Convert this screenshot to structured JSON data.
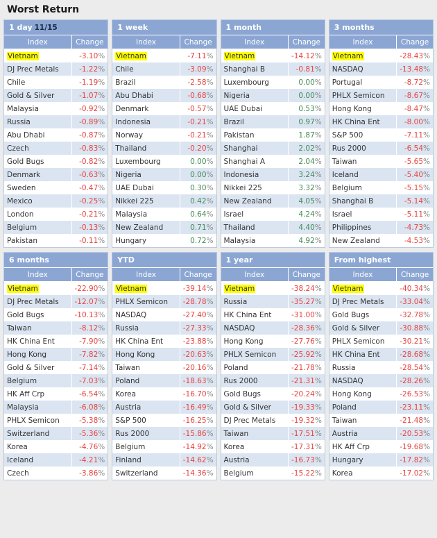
{
  "page": {
    "title": "Worst Return"
  },
  "columns": {
    "index": "Index",
    "change": "Change"
  },
  "panels": [
    {
      "id": "1-day",
      "title": "1 day",
      "date": "11/15",
      "rows": [
        {
          "index": "Vietnam",
          "highlight": true,
          "value": "-3.10",
          "pct": "%",
          "sign": "neg"
        },
        {
          "index": "DJ Prec Metals",
          "highlight": false,
          "value": "-1.22",
          "pct": "%",
          "sign": "neg"
        },
        {
          "index": "Chile",
          "highlight": false,
          "value": "-1.19",
          "pct": "%",
          "sign": "neg"
        },
        {
          "index": "Gold & Silver",
          "highlight": false,
          "value": "-1.07",
          "pct": "%",
          "sign": "neg"
        },
        {
          "index": "Malaysia",
          "highlight": false,
          "value": "-0.92",
          "pct": "%",
          "sign": "neg"
        },
        {
          "index": "Russia",
          "highlight": false,
          "value": "-0.89",
          "pct": "%",
          "sign": "neg"
        },
        {
          "index": "Abu Dhabi",
          "highlight": false,
          "value": "-0.87",
          "pct": "%",
          "sign": "neg"
        },
        {
          "index": "Czech",
          "highlight": false,
          "value": "-0.83",
          "pct": "%",
          "sign": "neg"
        },
        {
          "index": "Gold Bugs",
          "highlight": false,
          "value": "-0.82",
          "pct": "%",
          "sign": "neg"
        },
        {
          "index": "Denmark",
          "highlight": false,
          "value": "-0.63",
          "pct": "%",
          "sign": "neg"
        },
        {
          "index": "Sweden",
          "highlight": false,
          "value": "-0.47",
          "pct": "%",
          "sign": "neg"
        },
        {
          "index": "Mexico",
          "highlight": false,
          "value": "-0.25",
          "pct": "%",
          "sign": "neg"
        },
        {
          "index": "London",
          "highlight": false,
          "value": "-0.21",
          "pct": "%",
          "sign": "neg"
        },
        {
          "index": "Belgium",
          "highlight": false,
          "value": "-0.13",
          "pct": "%",
          "sign": "neg"
        },
        {
          "index": "Pakistan",
          "highlight": false,
          "value": "-0.11",
          "pct": "%",
          "sign": "neg"
        }
      ]
    },
    {
      "id": "1-week",
      "title": "1 week",
      "date": "",
      "rows": [
        {
          "index": "Vietnam",
          "highlight": true,
          "value": "-7.11",
          "pct": "%",
          "sign": "neg"
        },
        {
          "index": "Chile",
          "highlight": false,
          "value": "-3.09",
          "pct": "%",
          "sign": "neg"
        },
        {
          "index": "Brazil",
          "highlight": false,
          "value": "-2.58",
          "pct": "%",
          "sign": "neg"
        },
        {
          "index": "Abu Dhabi",
          "highlight": false,
          "value": "-0.68",
          "pct": "%",
          "sign": "neg"
        },
        {
          "index": "Denmark",
          "highlight": false,
          "value": "-0.57",
          "pct": "%",
          "sign": "neg"
        },
        {
          "index": "Indonesia",
          "highlight": false,
          "value": "-0.21",
          "pct": "%",
          "sign": "neg"
        },
        {
          "index": "Norway",
          "highlight": false,
          "value": "-0.21",
          "pct": "%",
          "sign": "neg"
        },
        {
          "index": "Thailand",
          "highlight": false,
          "value": "-0.20",
          "pct": "%",
          "sign": "neg"
        },
        {
          "index": "Luxembourg",
          "highlight": false,
          "value": "0.00",
          "pct": "%",
          "sign": "pos"
        },
        {
          "index": "Nigeria",
          "highlight": false,
          "value": "0.00",
          "pct": "%",
          "sign": "pos"
        },
        {
          "index": "UAE Dubai",
          "highlight": false,
          "value": "0.30",
          "pct": "%",
          "sign": "pos"
        },
        {
          "index": "Nikkei 225",
          "highlight": false,
          "value": "0.42",
          "pct": "%",
          "sign": "pos"
        },
        {
          "index": "Malaysia",
          "highlight": false,
          "value": "0.64",
          "pct": "%",
          "sign": "pos"
        },
        {
          "index": "New Zealand",
          "highlight": false,
          "value": "0.71",
          "pct": "%",
          "sign": "pos"
        },
        {
          "index": "Hungary",
          "highlight": false,
          "value": "0.72",
          "pct": "%",
          "sign": "pos"
        }
      ]
    },
    {
      "id": "1-month",
      "title": "1 month",
      "date": "",
      "rows": [
        {
          "index": "Vietnam",
          "highlight": true,
          "value": "-14.12",
          "pct": "%",
          "sign": "neg"
        },
        {
          "index": "Shanghai B",
          "highlight": false,
          "value": "-0.81",
          "pct": "%",
          "sign": "neg"
        },
        {
          "index": "Luxembourg",
          "highlight": false,
          "value": "0.00",
          "pct": "%",
          "sign": "pos"
        },
        {
          "index": "Nigeria",
          "highlight": false,
          "value": "0.00",
          "pct": "%",
          "sign": "pos"
        },
        {
          "index": "UAE Dubai",
          "highlight": false,
          "value": "0.53",
          "pct": "%",
          "sign": "pos"
        },
        {
          "index": "Brazil",
          "highlight": false,
          "value": "0.97",
          "pct": "%",
          "sign": "pos"
        },
        {
          "index": "Pakistan",
          "highlight": false,
          "value": "1.87",
          "pct": "%",
          "sign": "pos"
        },
        {
          "index": "Shanghai",
          "highlight": false,
          "value": "2.02",
          "pct": "%",
          "sign": "pos"
        },
        {
          "index": "Shanghai A",
          "highlight": false,
          "value": "2.04",
          "pct": "%",
          "sign": "pos"
        },
        {
          "index": "Indonesia",
          "highlight": false,
          "value": "3.24",
          "pct": "%",
          "sign": "pos"
        },
        {
          "index": "Nikkei 225",
          "highlight": false,
          "value": "3.32",
          "pct": "%",
          "sign": "pos"
        },
        {
          "index": "New Zealand",
          "highlight": false,
          "value": "4.05",
          "pct": "%",
          "sign": "pos"
        },
        {
          "index": "Israel",
          "highlight": false,
          "value": "4.24",
          "pct": "%",
          "sign": "pos"
        },
        {
          "index": "Thailand",
          "highlight": false,
          "value": "4.40",
          "pct": "%",
          "sign": "pos"
        },
        {
          "index": "Malaysia",
          "highlight": false,
          "value": "4.92",
          "pct": "%",
          "sign": "pos"
        }
      ]
    },
    {
      "id": "3-months",
      "title": "3 months",
      "date": "",
      "rows": [
        {
          "index": "Vietnam",
          "highlight": true,
          "value": "-28.43",
          "pct": "%",
          "sign": "neg"
        },
        {
          "index": "NASDAQ",
          "highlight": false,
          "value": "-13.48",
          "pct": "%",
          "sign": "neg"
        },
        {
          "index": "Portugal",
          "highlight": false,
          "value": "-8.72",
          "pct": "%",
          "sign": "neg"
        },
        {
          "index": "PHLX Semicon",
          "highlight": false,
          "value": "-8.67",
          "pct": "%",
          "sign": "neg"
        },
        {
          "index": "Hong Kong",
          "highlight": false,
          "value": "-8.47",
          "pct": "%",
          "sign": "neg"
        },
        {
          "index": "HK China Ent",
          "highlight": false,
          "value": "-8.00",
          "pct": "%",
          "sign": "neg"
        },
        {
          "index": "S&P 500",
          "highlight": false,
          "value": "-7.11",
          "pct": "%",
          "sign": "neg"
        },
        {
          "index": "Rus 2000",
          "highlight": false,
          "value": "-6.54",
          "pct": "%",
          "sign": "neg"
        },
        {
          "index": "Taiwan",
          "highlight": false,
          "value": "-5.65",
          "pct": "%",
          "sign": "neg"
        },
        {
          "index": "Iceland",
          "highlight": false,
          "value": "-5.40",
          "pct": "%",
          "sign": "neg"
        },
        {
          "index": "Belgium",
          "highlight": false,
          "value": "-5.15",
          "pct": "%",
          "sign": "neg"
        },
        {
          "index": "Shanghai B",
          "highlight": false,
          "value": "-5.14",
          "pct": "%",
          "sign": "neg"
        },
        {
          "index": "Israel",
          "highlight": false,
          "value": "-5.11",
          "pct": "%",
          "sign": "neg"
        },
        {
          "index": "Philippines",
          "highlight": false,
          "value": "-4.73",
          "pct": "%",
          "sign": "neg"
        },
        {
          "index": "New Zealand",
          "highlight": false,
          "value": "-4.53",
          "pct": "%",
          "sign": "neg"
        }
      ]
    },
    {
      "id": "6-months",
      "title": "6 months",
      "date": "",
      "rows": [
        {
          "index": "Vietnam",
          "highlight": true,
          "value": "-22.90",
          "pct": "%",
          "sign": "neg"
        },
        {
          "index": "DJ Prec Metals",
          "highlight": false,
          "value": "-12.07",
          "pct": "%",
          "sign": "neg"
        },
        {
          "index": "Gold Bugs",
          "highlight": false,
          "value": "-10.13",
          "pct": "%",
          "sign": "neg"
        },
        {
          "index": "Taiwan",
          "highlight": false,
          "value": "-8.12",
          "pct": "%",
          "sign": "neg"
        },
        {
          "index": "HK China Ent",
          "highlight": false,
          "value": "-7.90",
          "pct": "%",
          "sign": "neg"
        },
        {
          "index": "Hong Kong",
          "highlight": false,
          "value": "-7.82",
          "pct": "%",
          "sign": "neg"
        },
        {
          "index": "Gold & Silver",
          "highlight": false,
          "value": "-7.14",
          "pct": "%",
          "sign": "neg"
        },
        {
          "index": "Belgium",
          "highlight": false,
          "value": "-7.03",
          "pct": "%",
          "sign": "neg"
        },
        {
          "index": "HK Aff Crp",
          "highlight": false,
          "value": "-6.54",
          "pct": "%",
          "sign": "neg"
        },
        {
          "index": "Malaysia",
          "highlight": false,
          "value": "-6.08",
          "pct": "%",
          "sign": "neg"
        },
        {
          "index": "PHLX Semicon",
          "highlight": false,
          "value": "-5.38",
          "pct": "%",
          "sign": "neg"
        },
        {
          "index": "Switzerland",
          "highlight": false,
          "value": "-5.36",
          "pct": "%",
          "sign": "neg"
        },
        {
          "index": "Korea",
          "highlight": false,
          "value": "-4.76",
          "pct": "%",
          "sign": "neg"
        },
        {
          "index": "Iceland",
          "highlight": false,
          "value": "-4.21",
          "pct": "%",
          "sign": "neg"
        },
        {
          "index": "Czech",
          "highlight": false,
          "value": "-3.86",
          "pct": "%",
          "sign": "neg"
        }
      ]
    },
    {
      "id": "ytd",
      "title": "YTD",
      "date": "",
      "rows": [
        {
          "index": "Vietnam",
          "highlight": true,
          "value": "-39.14",
          "pct": "%",
          "sign": "neg"
        },
        {
          "index": "PHLX Semicon",
          "highlight": false,
          "value": "-28.78",
          "pct": "%",
          "sign": "neg"
        },
        {
          "index": "NASDAQ",
          "highlight": false,
          "value": "-27.40",
          "pct": "%",
          "sign": "neg"
        },
        {
          "index": "Russia",
          "highlight": false,
          "value": "-27.33",
          "pct": "%",
          "sign": "neg"
        },
        {
          "index": "HK China Ent",
          "highlight": false,
          "value": "-23.88",
          "pct": "%",
          "sign": "neg"
        },
        {
          "index": "Hong Kong",
          "highlight": false,
          "value": "-20.63",
          "pct": "%",
          "sign": "neg"
        },
        {
          "index": "Taiwan",
          "highlight": false,
          "value": "-20.16",
          "pct": "%",
          "sign": "neg"
        },
        {
          "index": "Poland",
          "highlight": false,
          "value": "-18.63",
          "pct": "%",
          "sign": "neg"
        },
        {
          "index": "Korea",
          "highlight": false,
          "value": "-16.70",
          "pct": "%",
          "sign": "neg"
        },
        {
          "index": "Austria",
          "highlight": false,
          "value": "-16.49",
          "pct": "%",
          "sign": "neg"
        },
        {
          "index": "S&P 500",
          "highlight": false,
          "value": "-16.25",
          "pct": "%",
          "sign": "neg"
        },
        {
          "index": "Rus 2000",
          "highlight": false,
          "value": "-15.86",
          "pct": "%",
          "sign": "neg"
        },
        {
          "index": "Belgium",
          "highlight": false,
          "value": "-14.92",
          "pct": "%",
          "sign": "neg"
        },
        {
          "index": "Finland",
          "highlight": false,
          "value": "-14.62",
          "pct": "%",
          "sign": "neg"
        },
        {
          "index": "Switzerland",
          "highlight": false,
          "value": "-14.36",
          "pct": "%",
          "sign": "neg"
        }
      ]
    },
    {
      "id": "1-year",
      "title": "1 year",
      "date": "",
      "rows": [
        {
          "index": "Vietnam",
          "highlight": true,
          "value": "-38.24",
          "pct": "%",
          "sign": "neg"
        },
        {
          "index": "Russia",
          "highlight": false,
          "value": "-35.27",
          "pct": "%",
          "sign": "neg"
        },
        {
          "index": "HK China Ent",
          "highlight": false,
          "value": "-31.00",
          "pct": "%",
          "sign": "neg"
        },
        {
          "index": "NASDAQ",
          "highlight": false,
          "value": "-28.36",
          "pct": "%",
          "sign": "neg"
        },
        {
          "index": "Hong Kong",
          "highlight": false,
          "value": "-27.76",
          "pct": "%",
          "sign": "neg"
        },
        {
          "index": "PHLX Semicon",
          "highlight": false,
          "value": "-25.92",
          "pct": "%",
          "sign": "neg"
        },
        {
          "index": "Poland",
          "highlight": false,
          "value": "-21.78",
          "pct": "%",
          "sign": "neg"
        },
        {
          "index": "Rus 2000",
          "highlight": false,
          "value": "-21.31",
          "pct": "%",
          "sign": "neg"
        },
        {
          "index": "Gold Bugs",
          "highlight": false,
          "value": "-20.24",
          "pct": "%",
          "sign": "neg"
        },
        {
          "index": "Gold & Silver",
          "highlight": false,
          "value": "-19.33",
          "pct": "%",
          "sign": "neg"
        },
        {
          "index": "DJ Prec Metals",
          "highlight": false,
          "value": "-19.32",
          "pct": "%",
          "sign": "neg"
        },
        {
          "index": "Taiwan",
          "highlight": false,
          "value": "-17.51",
          "pct": "%",
          "sign": "neg"
        },
        {
          "index": "Korea",
          "highlight": false,
          "value": "-17.31",
          "pct": "%",
          "sign": "neg"
        },
        {
          "index": "Austria",
          "highlight": false,
          "value": "-16.73",
          "pct": "%",
          "sign": "neg"
        },
        {
          "index": "Belgium",
          "highlight": false,
          "value": "-15.22",
          "pct": "%",
          "sign": "neg"
        }
      ]
    },
    {
      "id": "from-highest",
      "title": "From highest",
      "date": "",
      "rows": [
        {
          "index": "Vietnam",
          "highlight": true,
          "value": "-40.34",
          "pct": "%",
          "sign": "neg"
        },
        {
          "index": "DJ Prec Metals",
          "highlight": false,
          "value": "-33.04",
          "pct": "%",
          "sign": "neg"
        },
        {
          "index": "Gold Bugs",
          "highlight": false,
          "value": "-32.78",
          "pct": "%",
          "sign": "neg"
        },
        {
          "index": "Gold & Silver",
          "highlight": false,
          "value": "-30.88",
          "pct": "%",
          "sign": "neg"
        },
        {
          "index": "PHLX Semicon",
          "highlight": false,
          "value": "-30.21",
          "pct": "%",
          "sign": "neg"
        },
        {
          "index": "HK China Ent",
          "highlight": false,
          "value": "-28.68",
          "pct": "%",
          "sign": "neg"
        },
        {
          "index": "Russia",
          "highlight": false,
          "value": "-28.54",
          "pct": "%",
          "sign": "neg"
        },
        {
          "index": "NASDAQ",
          "highlight": false,
          "value": "-28.26",
          "pct": "%",
          "sign": "neg"
        },
        {
          "index": "Hong Kong",
          "highlight": false,
          "value": "-26.53",
          "pct": "%",
          "sign": "neg"
        },
        {
          "index": "Poland",
          "highlight": false,
          "value": "-23.11",
          "pct": "%",
          "sign": "neg"
        },
        {
          "index": "Taiwan",
          "highlight": false,
          "value": "-21.48",
          "pct": "%",
          "sign": "neg"
        },
        {
          "index": "Austria",
          "highlight": false,
          "value": "-20.53",
          "pct": "%",
          "sign": "neg"
        },
        {
          "index": "HK Aff Crp",
          "highlight": false,
          "value": "-19.68",
          "pct": "%",
          "sign": "neg"
        },
        {
          "index": "Hungary",
          "highlight": false,
          "value": "-17.82",
          "pct": "%",
          "sign": "neg"
        },
        {
          "index": "Korea",
          "highlight": false,
          "value": "-17.02",
          "pct": "%",
          "sign": "neg"
        }
      ]
    }
  ],
  "colors": {
    "header_blue": "#8ca6d4",
    "row_alt": "#dbe5f1",
    "negative": "#e8413c",
    "positive": "#3f8a52",
    "highlight": "#ffff00",
    "page_bg": "#ececec"
  }
}
